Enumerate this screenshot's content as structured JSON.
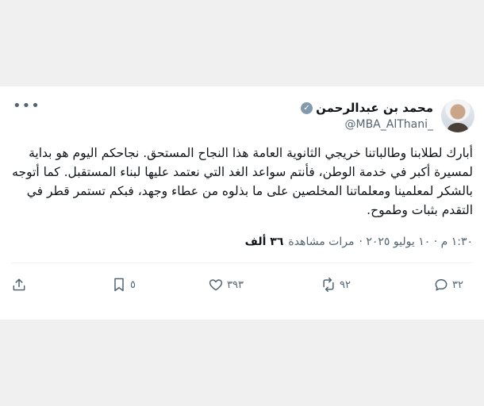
{
  "tweet": {
    "author_name": "محمد بن عبدالرحمن",
    "handle": "@MBA_AlThani_",
    "verified_icon": "verified-check",
    "text": "أبارك لطلابنا وطالباتنا خريجي الثانوية العامة هذا النجاح المستحق. نجاحكم اليوم هو بداية لمسيرة أكبر في خدمة الوطن، فأنتم سواعد الغد التي نعتمد عليها لبناء المستقبل. كما أتوجه بالشكر لمعلمينا ومعلماتنا المخلصين على ما بذلوه من عطاء وجهد، فبكم تستمر قطر في التقدم بثبات وطموح.",
    "timestamp": "١:٣٠ م · ١٠ يوليو ٢٠٢٥ ·",
    "views_count": "٣٦ ألف",
    "views_label": "مرات مشاهدة"
  },
  "actions": {
    "reply_count": "٣٢",
    "retweet_count": "٩٢",
    "like_count": "٣٩٣",
    "bookmark_count": "٥"
  }
}
